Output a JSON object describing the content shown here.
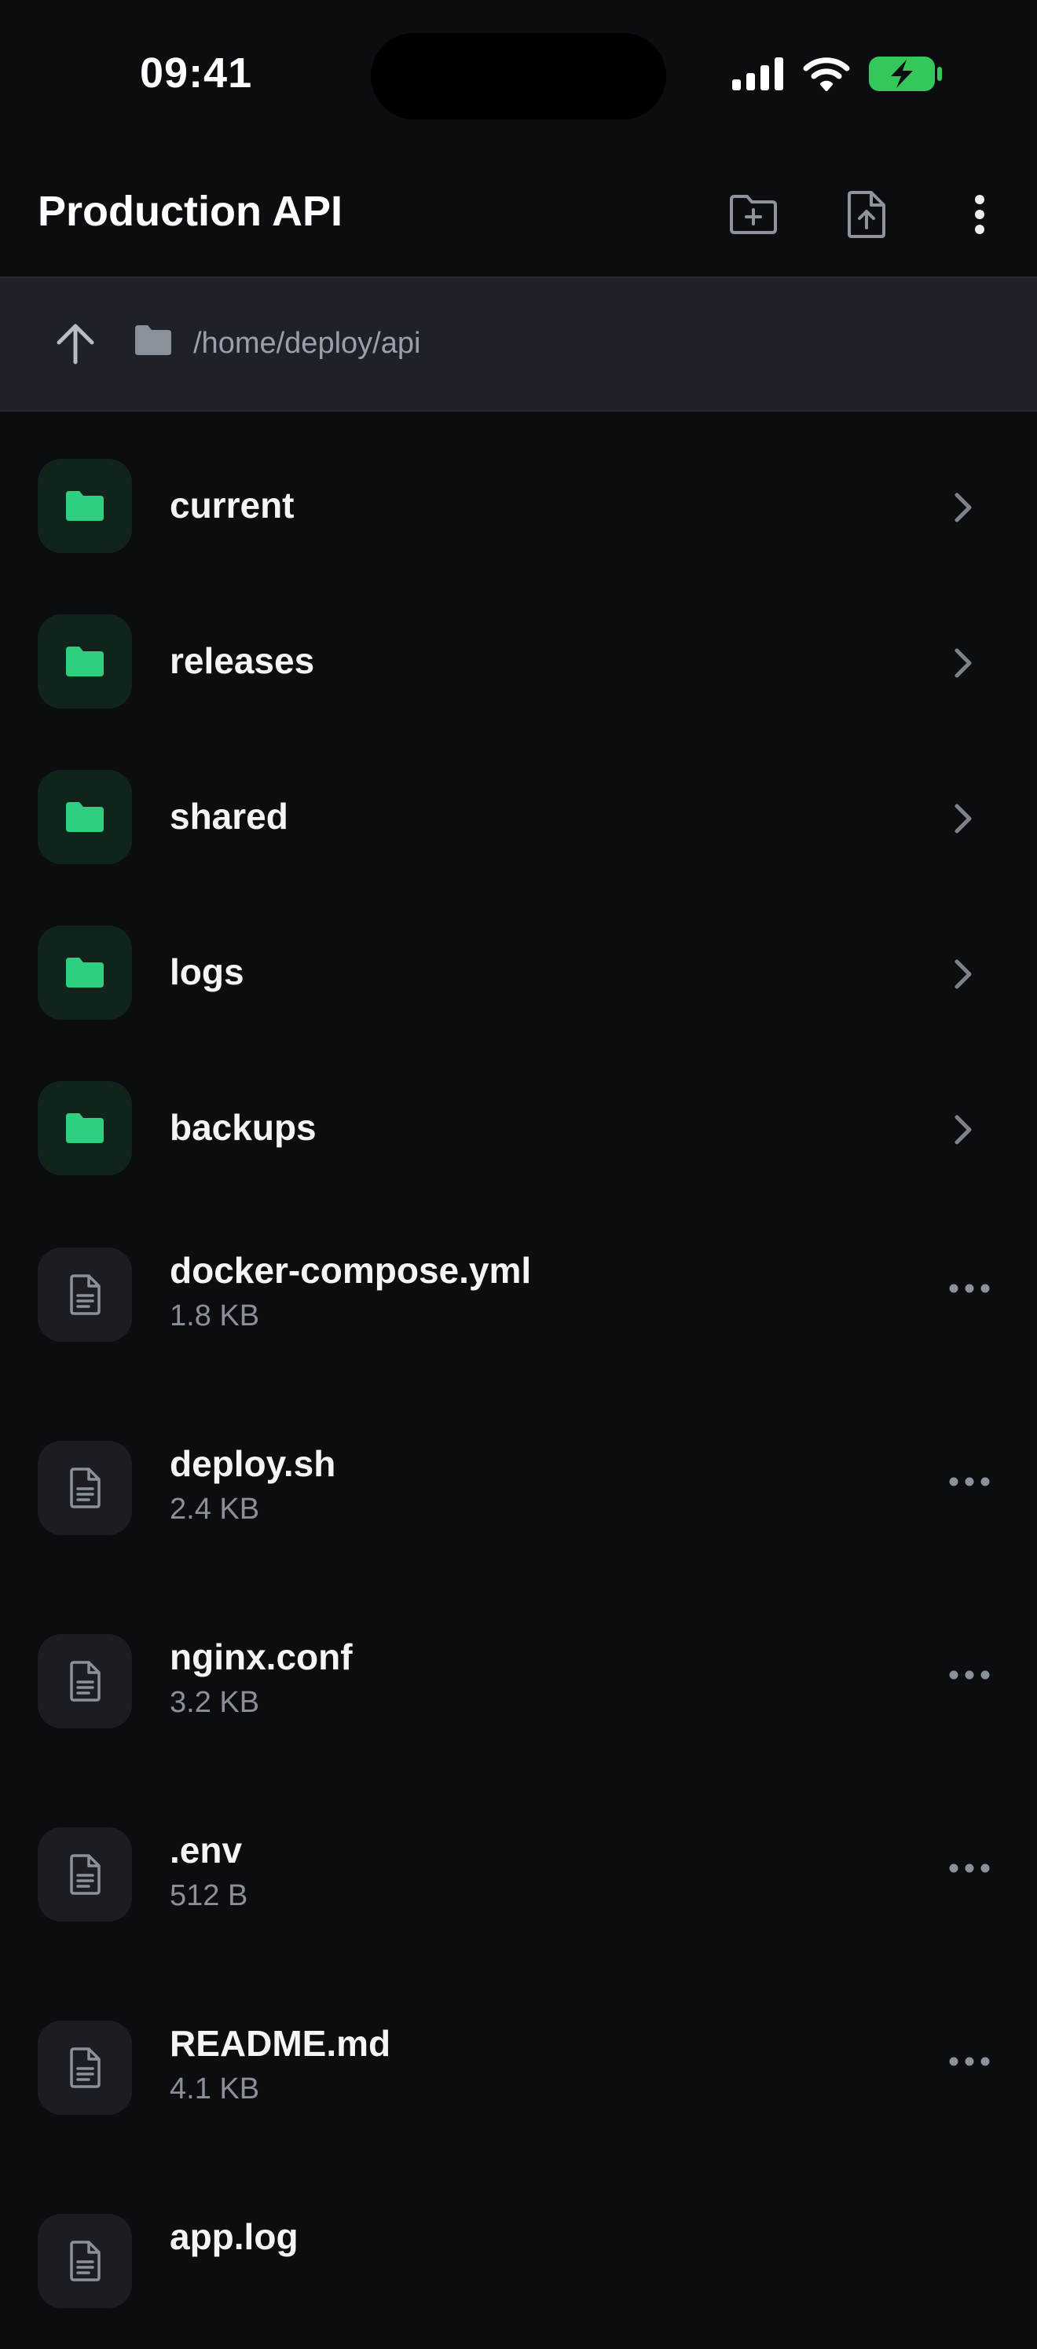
{
  "status": {
    "time": "09:41"
  },
  "header": {
    "title": "Production API"
  },
  "path": {
    "text": "/home/deploy/api"
  },
  "folders": [
    {
      "name": "current"
    },
    {
      "name": "releases"
    },
    {
      "name": "shared"
    },
    {
      "name": "logs"
    },
    {
      "name": "backups"
    }
  ],
  "files": [
    {
      "name": "docker-compose.yml",
      "size": "1.8 KB"
    },
    {
      "name": "deploy.sh",
      "size": "2.4 KB"
    },
    {
      "name": "nginx.conf",
      "size": "3.2 KB"
    },
    {
      "name": ".env",
      "size": "512 B"
    },
    {
      "name": "README.md",
      "size": "4.1 KB"
    },
    {
      "name": "app.log",
      "size": ""
    }
  ],
  "colors": {
    "accent": "#2ecf7f",
    "background": "#0c0d10",
    "pathbar": "#1e2128",
    "battery": "#35c759"
  },
  "icons": [
    "signal-icon",
    "wifi-icon",
    "battery-charging-icon",
    "new-folder-icon",
    "upload-file-icon",
    "more-vertical-icon",
    "arrow-up-icon",
    "folder-icon",
    "file-icon",
    "chevron-right-icon",
    "more-horizontal-icon"
  ]
}
